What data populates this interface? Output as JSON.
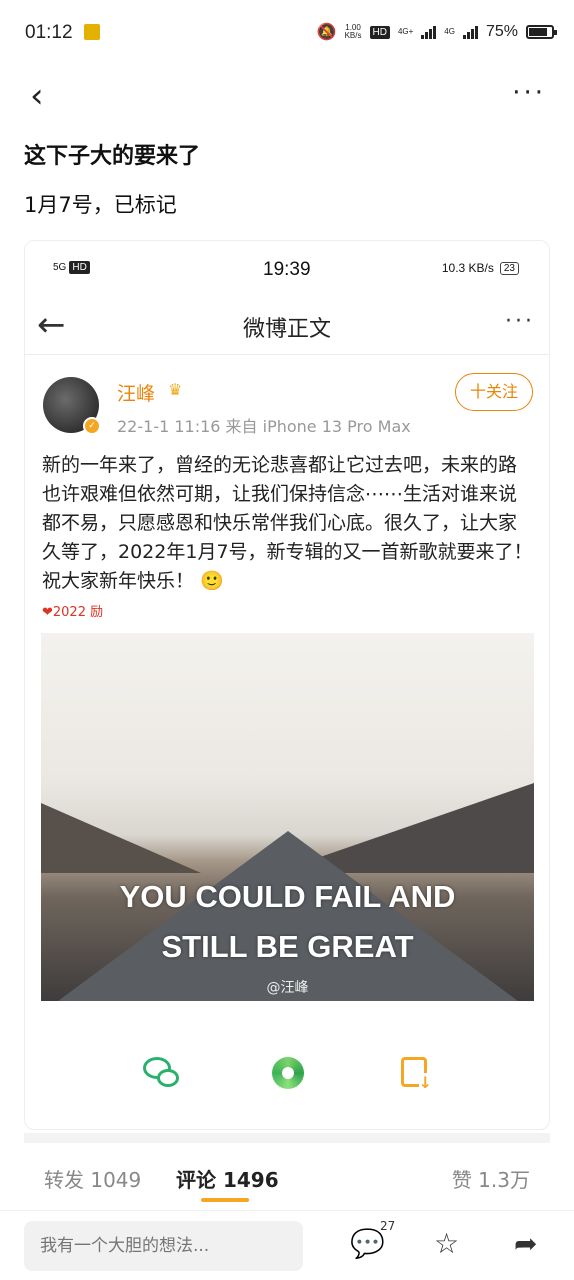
{
  "status": {
    "time": "01:12",
    "net_speed": "1.00",
    "net_unit": "KB/s",
    "hd": "HD",
    "sig1": "4G+",
    "sig2": "4G",
    "battery": "75%"
  },
  "nav": {
    "back": "‹",
    "more": "···"
  },
  "post_title": "这下子大的要来了",
  "post_desc": "1月7号，已标记",
  "screenshot": {
    "status": {
      "left": "5G",
      "hd": "HD",
      "time": "19:39",
      "speed": "10.3 KB/s",
      "battery": "23"
    },
    "nav_title": "微博正文",
    "user": {
      "name": "汪峰",
      "meta": "22-1-1 11:16  来自 iPhone 13 Pro Max"
    },
    "follow": "十关注",
    "text": "新的一年来了，曾经的无论悲喜都让它过去吧，未来的路也许艰难但依然可期，让我们保持信念⋯⋯生活对谁来说都不易，只愿感恩和快乐常伴我们心底。很久了，让大家久等了，2022年1月7号，新专辑的又一首新歌就要来了！祝大家新年快乐！",
    "emoji": "🙂",
    "tags": "❤2022 励",
    "image_line1": "YOU COULD FAIL AND",
    "image_line2": "STILL BE GREAT",
    "watermark": "@汪峰"
  },
  "tabs": {
    "repost": "转发 1049",
    "comment": "评论 1496",
    "like": "赞 1.3万"
  },
  "bottom": {
    "placeholder": "我有一个大胆的想法...",
    "comment_count": "27"
  }
}
